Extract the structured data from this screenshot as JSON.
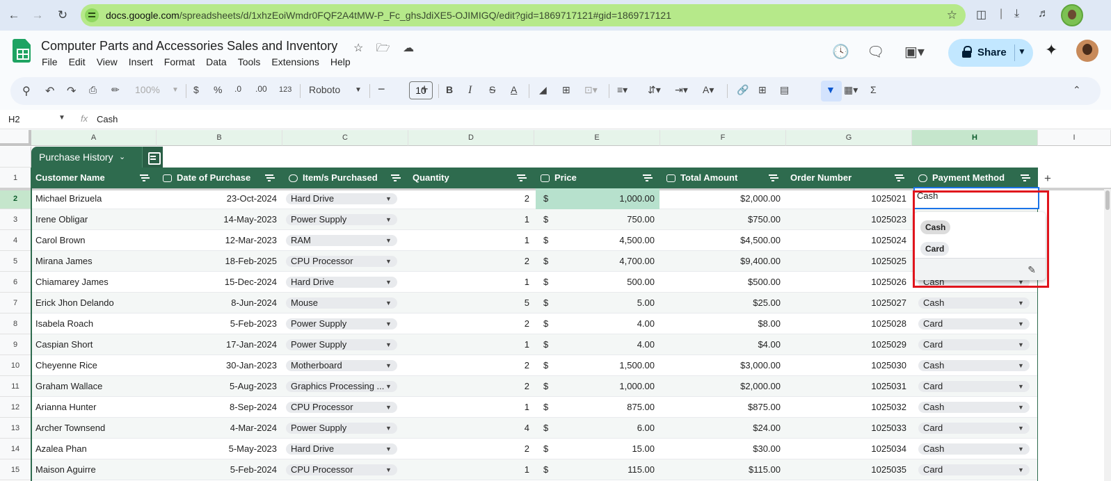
{
  "browser": {
    "url_domain": "docs.google.com",
    "url_path": "/spreadsheets/d/1xhzEoiWmdr0FQF2A4tMW-P_Fc_ghsJdiXE5-OJIMIGQ/edit?gid=1869717121#gid=1869717121"
  },
  "doc": {
    "title": "Computer Parts and Accessories Sales and Inventory",
    "share_label": "Share"
  },
  "menu": [
    "File",
    "Edit",
    "View",
    "Insert",
    "Format",
    "Data",
    "Tools",
    "Extensions",
    "Help"
  ],
  "toolbar": {
    "zoom": "100%",
    "currency": "$",
    "percent": "%",
    "dec_decrease": ".0",
    "dec_increase": ".00",
    "number_format": "123",
    "font": "Roboto",
    "font_size": "10"
  },
  "formula_bar": {
    "cell_ref": "H2",
    "fx": "fx",
    "value": "Cash"
  },
  "columns": [
    "A",
    "B",
    "C",
    "D",
    "E",
    "F",
    "G",
    "H",
    "I"
  ],
  "table": {
    "name": "Purchase History",
    "headers": [
      "Customer Name",
      "Date of Purchase",
      "Item/s Purchased",
      "Quantity",
      "Price",
      "Total Amount",
      "Order Number",
      "Payment Method"
    ],
    "rows": [
      {
        "num": "1"
      },
      {
        "num": "2",
        "name": "Michael Brizuela",
        "date": "23-Oct-2024",
        "item": "Hard Drive",
        "qty": "2",
        "cur": "$",
        "price": "1,000.00",
        "total": "$2,000.00",
        "order": "1025021",
        "pay": "Cash"
      },
      {
        "num": "3",
        "name": "Irene Obligar",
        "date": "14-May-2023",
        "item": "Power Supply",
        "qty": "1",
        "cur": "$",
        "price": "750.00",
        "total": "$750.00",
        "order": "1025023",
        "pay": ""
      },
      {
        "num": "4",
        "name": "Carol Brown",
        "date": "12-Mar-2023",
        "item": "RAM",
        "qty": "1",
        "cur": "$",
        "price": "4,500.00",
        "total": "$4,500.00",
        "order": "1025024",
        "pay": ""
      },
      {
        "num": "5",
        "name": "Mirana James",
        "date": "18-Feb-2025",
        "item": "CPU Processor",
        "qty": "2",
        "cur": "$",
        "price": "4,700.00",
        "total": "$9,400.00",
        "order": "1025025",
        "pay": ""
      },
      {
        "num": "6",
        "name": "Chiamarey James",
        "date": "15-Dec-2024",
        "item": "Hard Drive",
        "qty": "1",
        "cur": "$",
        "price": "500.00",
        "total": "$500.00",
        "order": "1025026",
        "pay": "Cash"
      },
      {
        "num": "7",
        "name": "Erick Jhon Delando",
        "date": "8-Jun-2024",
        "item": "Mouse",
        "qty": "5",
        "cur": "$",
        "price": "5.00",
        "total": "$25.00",
        "order": "1025027",
        "pay": "Cash"
      },
      {
        "num": "8",
        "name": "Isabela Roach",
        "date": "5-Feb-2023",
        "item": "Power Supply",
        "qty": "2",
        "cur": "$",
        "price": "4.00",
        "total": "$8.00",
        "order": "1025028",
        "pay": "Card"
      },
      {
        "num": "9",
        "name": "Caspian Short",
        "date": "17-Jan-2024",
        "item": "Power Supply",
        "qty": "1",
        "cur": "$",
        "price": "4.00",
        "total": "$4.00",
        "order": "1025029",
        "pay": "Card"
      },
      {
        "num": "10",
        "name": "Cheyenne Rice",
        "date": "30-Jan-2023",
        "item": "Motherboard",
        "qty": "2",
        "cur": "$",
        "price": "1,500.00",
        "total": "$3,000.00",
        "order": "1025030",
        "pay": "Cash"
      },
      {
        "num": "11",
        "name": "Graham Wallace",
        "date": "5-Aug-2023",
        "item": "Graphics Processing ...",
        "qty": "2",
        "cur": "$",
        "price": "1,000.00",
        "total": "$2,000.00",
        "order": "1025031",
        "pay": "Card"
      },
      {
        "num": "12",
        "name": "Arianna Hunter",
        "date": "8-Sep-2024",
        "item": "CPU Processor",
        "qty": "1",
        "cur": "$",
        "price": "875.00",
        "total": "$875.00",
        "order": "1025032",
        "pay": "Cash"
      },
      {
        "num": "13",
        "name": "Archer Townsend",
        "date": "4-Mar-2024",
        "item": "Power Supply",
        "qty": "4",
        "cur": "$",
        "price": "6.00",
        "total": "$24.00",
        "order": "1025033",
        "pay": "Card"
      },
      {
        "num": "14",
        "name": "Azalea Phan",
        "date": "5-May-2023",
        "item": "Hard Drive",
        "qty": "2",
        "cur": "$",
        "price": "15.00",
        "total": "$30.00",
        "order": "1025034",
        "pay": "Cash"
      },
      {
        "num": "15",
        "name": "Maison Aguirre",
        "date": "5-Feb-2024",
        "item": "CPU Processor",
        "qty": "1",
        "cur": "$",
        "price": "115.00",
        "total": "$115.00",
        "order": "1025035",
        "pay": "Card"
      }
    ]
  },
  "dropdown": {
    "options": [
      "Cash",
      "Card"
    ]
  },
  "colors": {
    "table_header": "#2e6b4e",
    "url_bar": "#b6e98a",
    "selection_fill": "#b7e1cd",
    "active_border": "#1a73e8",
    "highlight": "#e0141c"
  }
}
